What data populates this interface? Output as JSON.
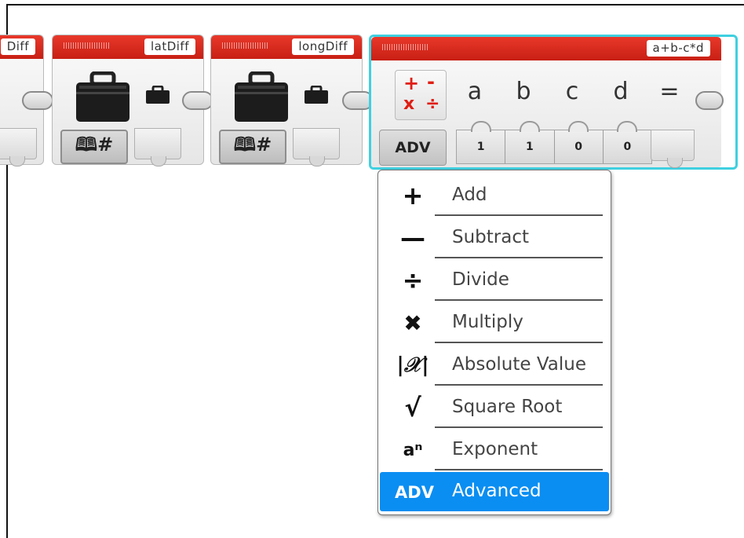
{
  "blocks": {
    "partial_title": "Diff",
    "lat_title": "latDiff",
    "long_title": "longDiff"
  },
  "variable_mode_label": "🕮#",
  "math_block": {
    "title": "a+b-c*d",
    "mode_label": "ADV",
    "equals": "=",
    "params": [
      "a",
      "b",
      "c",
      "d"
    ],
    "values": [
      "1",
      "1",
      "0",
      "0"
    ],
    "accent_color": "#3fd0e0",
    "header_color": "#d8291d"
  },
  "menu": {
    "items": [
      {
        "icon": "plus-icon",
        "glyph": "+",
        "label": "Add"
      },
      {
        "icon": "minus-icon",
        "glyph": "—",
        "label": "Subtract"
      },
      {
        "icon": "divide-icon",
        "glyph": "÷",
        "label": "Divide"
      },
      {
        "icon": "multiply-icon",
        "glyph": "✖",
        "label": "Multiply"
      },
      {
        "icon": "absolute-value-icon",
        "glyph": "|𝒳|",
        "label": "Absolute Value"
      },
      {
        "icon": "square-root-icon",
        "glyph": "√",
        "label": "Square Root"
      },
      {
        "icon": "exponent-icon",
        "glyph": "aⁿ",
        "label": "Exponent"
      },
      {
        "icon": "advanced-icon",
        "glyph": "ADV",
        "label": "Advanced"
      }
    ],
    "selected_index": 7,
    "selected_color": "#0a8ef2"
  }
}
